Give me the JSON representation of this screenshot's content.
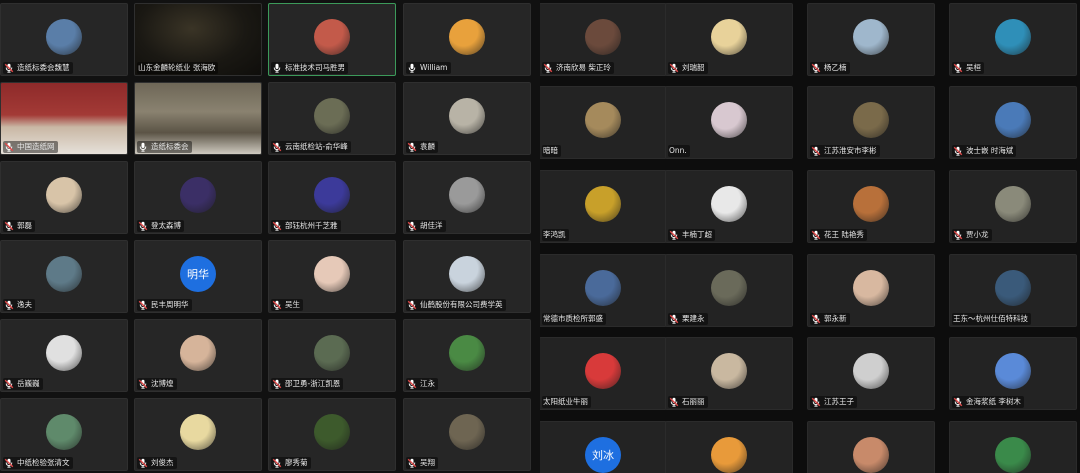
{
  "colors": {
    "tile_bg": "#262626",
    "active_border": "#3c9a5a",
    "mic_muted": "#e04a4a",
    "mic_on": "#ffffff",
    "blue_avatar": "#1e6fe0"
  },
  "left_panel": {
    "participants": [
      {
        "name": "造纸标委会魏慧",
        "mic": "muted",
        "avatar": "photo",
        "color": "#5a7ea8"
      },
      {
        "name": "山东金麟轮纸业 张海欧",
        "mic": "none",
        "avatar": "video-dark",
        "color": "#26231c"
      },
      {
        "name": "标准技术司马胜男",
        "mic": "on",
        "avatar": "photo",
        "color": "#c35a4a",
        "active": true
      },
      {
        "name": "William",
        "mic": "on",
        "avatar": "photo",
        "color": "#e8a13c"
      },
      {
        "name": "中国造纸网",
        "mic": "muted",
        "avatar": "video-room",
        "color": "#8a2b2b"
      },
      {
        "name": "造纸标委会",
        "mic": "on",
        "avatar": "video-office",
        "color": "#7a6e58"
      },
      {
        "name": "云南纸检站-俞华峰",
        "mic": "muted",
        "avatar": "photo",
        "color": "#6b6d55"
      },
      {
        "name": "袁麟",
        "mic": "muted",
        "avatar": "photo",
        "color": "#b8b3a6"
      },
      {
        "name": "郭磊",
        "mic": "muted",
        "avatar": "photo",
        "color": "#d8c4a8"
      },
      {
        "name": "登太森博",
        "mic": "muted",
        "avatar": "photo",
        "color": "#3b2f66"
      },
      {
        "name": "部钰杭州千芝雅",
        "mic": "muted",
        "avatar": "photo",
        "color": "#3c3a9a"
      },
      {
        "name": "胡佳洋",
        "mic": "muted",
        "avatar": "photo",
        "color": "#9a9a9a"
      },
      {
        "name": "逸夫",
        "mic": "muted",
        "avatar": "photo",
        "color": "#5e7a88"
      },
      {
        "name": "民丰周明华",
        "mic": "muted",
        "avatar": "text",
        "avatar_text": "明华",
        "color": "#1e6fe0"
      },
      {
        "name": "吴生",
        "mic": "muted",
        "avatar": "photo",
        "color": "#e6c9b8"
      },
      {
        "name": "仙鹤股份有限公司费学英",
        "mic": "muted",
        "avatar": "photo",
        "color": "#c9d3dd"
      },
      {
        "name": "岳巍巍",
        "mic": "muted",
        "avatar": "photo",
        "color": "#e0e0e0"
      },
      {
        "name": "沈博煌",
        "mic": "muted",
        "avatar": "photo",
        "color": "#d6b49a"
      },
      {
        "name": "邵卫勇-浙江凯恩",
        "mic": "muted",
        "avatar": "photo",
        "color": "#5b6b52"
      },
      {
        "name": "江永",
        "mic": "muted",
        "avatar": "photo",
        "color": "#4a8a44"
      },
      {
        "name": "中纸检验张清文",
        "mic": "muted",
        "avatar": "photo",
        "color": "#5f8a6b"
      },
      {
        "name": "刘俊杰",
        "mic": "muted",
        "avatar": "photo",
        "color": "#e8d9a0"
      },
      {
        "name": "廖秀菊",
        "mic": "muted",
        "avatar": "photo",
        "color": "#3d5a2c"
      },
      {
        "name": "吴翔",
        "mic": "muted",
        "avatar": "photo",
        "color": "#6e6552"
      }
    ]
  },
  "right_panel": {
    "participants": [
      {
        "name": "济南欣易 柴正玲",
        "mic": "muted",
        "avatar": "photo",
        "color": "#6b4a3c"
      },
      {
        "name": "刘瑞韶",
        "mic": "muted",
        "avatar": "photo",
        "color": "#e8d29a"
      },
      {
        "name": "杨乙楠",
        "mic": "muted",
        "avatar": "photo",
        "color": "#9fb7cc"
      },
      {
        "name": "吴桓",
        "mic": "muted",
        "avatar": "photo",
        "color": "#2f8fb8"
      },
      {
        "name": "暗暗",
        "mic": "none",
        "avatar": "photo",
        "color": "#a58a5c"
      },
      {
        "name": "Onn.",
        "mic": "none",
        "avatar": "photo",
        "color": "#d8c8d0"
      },
      {
        "name": "江苏淮安市李彬",
        "mic": "muted",
        "avatar": "photo",
        "color": "#7a6a4a"
      },
      {
        "name": "波士嵌 时海斌",
        "mic": "muted",
        "avatar": "photo",
        "color": "#4a7ab8"
      },
      {
        "name": "李鸿凯",
        "mic": "none",
        "avatar": "photo",
        "color": "#c8a02a"
      },
      {
        "name": "丰楠丁超",
        "mic": "muted",
        "avatar": "photo",
        "color": "#e8e8e8"
      },
      {
        "name": "花王 陆艳秀",
        "mic": "muted",
        "avatar": "photo",
        "color": "#b8703a"
      },
      {
        "name": "贾小龙",
        "mic": "muted",
        "avatar": "photo",
        "color": "#8a8a7a"
      },
      {
        "name": "常德市质检所郭盛",
        "mic": "none",
        "avatar": "photo",
        "color": "#4a6a9a"
      },
      {
        "name": "栗建永",
        "mic": "muted",
        "avatar": "photo",
        "color": "#6a6a5a"
      },
      {
        "name": "郭永新",
        "mic": "muted",
        "avatar": "photo",
        "color": "#d8b8a0"
      },
      {
        "name": "王东～杭州仕佰特科技",
        "mic": "none",
        "avatar": "photo",
        "color": "#3a5a7a"
      },
      {
        "name": "太阳纸业牛丽",
        "mic": "none",
        "avatar": "photo",
        "color": "#d83a3a"
      },
      {
        "name": "石丽丽",
        "mic": "muted",
        "avatar": "photo",
        "color": "#c9b8a0"
      },
      {
        "name": "江苏王子",
        "mic": "muted",
        "avatar": "photo",
        "color": "#cfcfcf"
      },
      {
        "name": "金海浆纸 李树木",
        "mic": "muted",
        "avatar": "photo",
        "color": "#5a8ad8"
      },
      {
        "name": "",
        "mic": "none",
        "avatar": "text",
        "avatar_text": "刘冰",
        "color": "#1e6fe0"
      },
      {
        "name": "",
        "mic": "none",
        "avatar": "photo",
        "color": "#e89a3a"
      },
      {
        "name": "",
        "mic": "none",
        "avatar": "photo",
        "color": "#c88a6a"
      },
      {
        "name": "",
        "mic": "none",
        "avatar": "photo",
        "color": "#3a8a4a"
      }
    ]
  }
}
